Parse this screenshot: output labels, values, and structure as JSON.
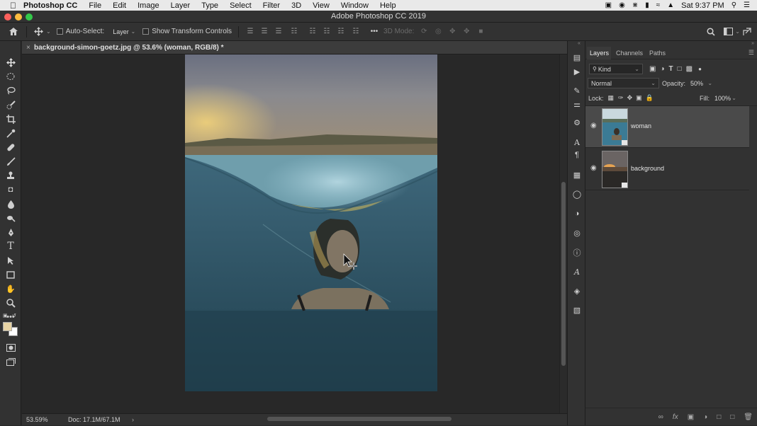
{
  "menubar": {
    "apple": "",
    "app_name": "Photoshop CC",
    "menus": [
      "File",
      "Edit",
      "Image",
      "Layer",
      "Type",
      "Select",
      "Filter",
      "3D",
      "View",
      "Window",
      "Help"
    ],
    "clock": "Sat 9:37 PM"
  },
  "window": {
    "title": "Adobe Photoshop CC 2019"
  },
  "options_bar": {
    "auto_select_label": "Auto-Select:",
    "auto_select_target": "Layer",
    "show_transform_label": "Show Transform Controls",
    "mode_3d_label": "3D Mode:"
  },
  "document": {
    "tab_title": "background-simon-goetz.jpg @ 53.6% (woman, RGB/8) *",
    "zoom": "53.59%",
    "doc_size": "Doc: 17.1M/67.1M"
  },
  "layers_panel": {
    "tabs": [
      "Layers",
      "Channels",
      "Paths"
    ],
    "filter_kind": "Kind",
    "blend_mode": "Normal",
    "opacity_label": "Opacity:",
    "opacity_value": "50%",
    "lock_label": "Lock:",
    "fill_label": "Fill:",
    "fill_value": "100%",
    "layers": [
      {
        "name": "woman",
        "visible": true,
        "selected": true
      },
      {
        "name": "background",
        "visible": true,
        "selected": false
      }
    ]
  },
  "colors": {
    "foreground": "#e8d4a4",
    "background": "#ffffff",
    "ui_dark": "#323232",
    "canvas_bg": "#282828"
  }
}
